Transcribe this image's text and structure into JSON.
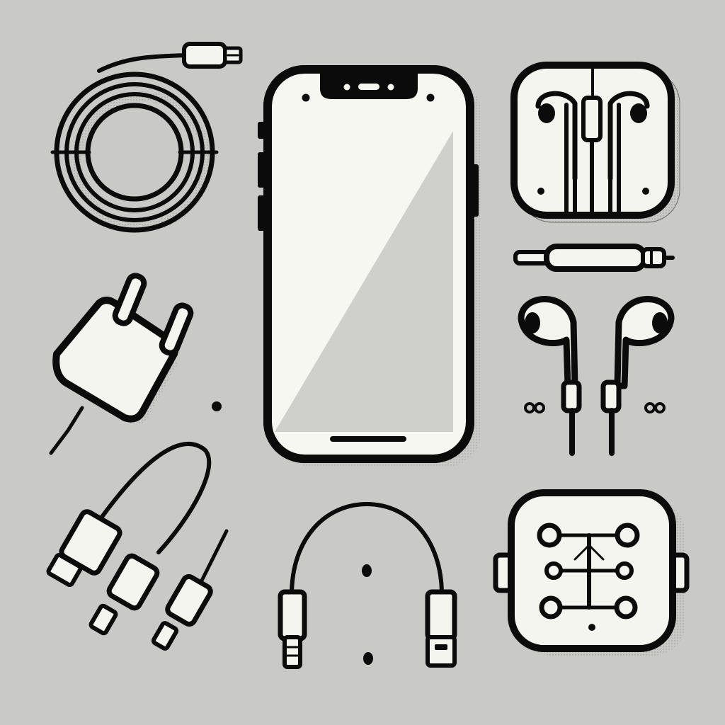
{
  "colors": {
    "background": "#c9c9c7",
    "outline": "#0b0b0b",
    "fill": "#f5f5ef",
    "screen_shade": "#cfcfcb",
    "shadow": "#8e8e8b"
  },
  "objects": [
    {
      "name": "coiled-cable-icon"
    },
    {
      "name": "smartphone-icon"
    },
    {
      "name": "earphones-case-icon"
    },
    {
      "name": "audio-jack-adapter-icon"
    },
    {
      "name": "earbuds-icon"
    },
    {
      "name": "wall-charger-icon"
    },
    {
      "name": "usb-and-aux-cables-icon"
    },
    {
      "name": "headphone-cable-icon"
    },
    {
      "name": "circuit-module-icon"
    }
  ]
}
